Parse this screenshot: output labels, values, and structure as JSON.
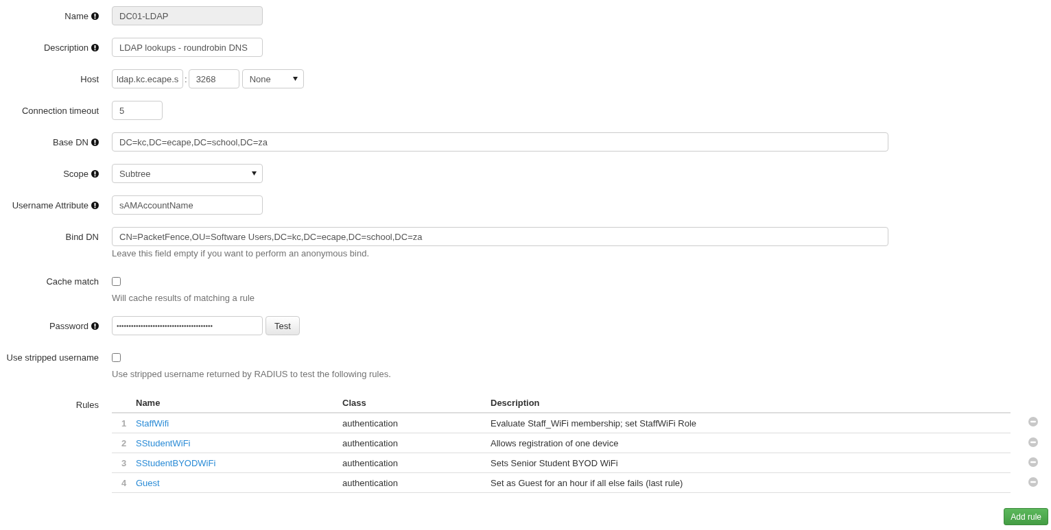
{
  "fields": [
    {
      "kind": "text",
      "label": "Name",
      "info": true,
      "value": "DC01-LDAP",
      "disabled": true
    },
    {
      "kind": "text",
      "label": "Description",
      "info": true,
      "value": "LDAP lookups - roundrobin DNS",
      "disabled": false
    },
    {
      "kind": "host",
      "label": "Host",
      "info": false,
      "value": "ldap.kc.ecape.s",
      "separator": ":",
      "port": "3268",
      "option": "None"
    },
    {
      "kind": "number",
      "label": "Connection timeout",
      "info": false,
      "value": "5"
    },
    {
      "kind": "long_text",
      "label": "Base DN",
      "info": true,
      "value": "DC=kc,DC=ecape,DC=school,DC=za",
      "disabled": false
    },
    {
      "kind": "select",
      "label": "Scope",
      "info": true,
      "option": "Subtree"
    },
    {
      "kind": "text",
      "label": "Username Attribute",
      "info": true,
      "value": "sAMAccountName",
      "disabled": false
    },
    {
      "kind": "long_text",
      "label": "Bind DN",
      "info": false,
      "value": "CN=PacketFence,OU=Software Users,DC=kc,DC=ecape,DC=school,DC=za",
      "disabled": false,
      "help": "Leave this field empty if you want to perform an anonymous bind."
    },
    {
      "kind": "checkbox",
      "label": "Cache match",
      "info": false,
      "checked": false,
      "help": "Will cache results of matching a rule"
    },
    {
      "kind": "password",
      "label": "Password",
      "info": true,
      "value": "••••••••••••••••••••••••••••••••••••••••",
      "button": "Test"
    },
    {
      "kind": "checkbox",
      "label": "Use stripped username",
      "info": false,
      "checked": false,
      "help": "Use stripped username returned by RADIUS to test the following rules."
    }
  ],
  "rules": {
    "label": "Rules",
    "columns": [
      "Name",
      "Class",
      "Description"
    ],
    "rows": [
      {
        "index": "1",
        "name": "StaffWifi",
        "class": "authentication",
        "description": "Evaluate Staff_WiFi membership; set StaffWiFi Role"
      },
      {
        "index": "2",
        "name": "SStudentWiFi",
        "class": "authentication",
        "description": "Allows registration of one device"
      },
      {
        "index": "3",
        "name": "SStudentBYODWiFi",
        "class": "authentication",
        "description": "Sets Senior Student BYOD WiFi"
      },
      {
        "index": "4",
        "name": "Guest",
        "class": "authentication",
        "description": "Set as Guest for an hour if all else fails (last rule)"
      }
    ],
    "add_button": "Add rule"
  }
}
